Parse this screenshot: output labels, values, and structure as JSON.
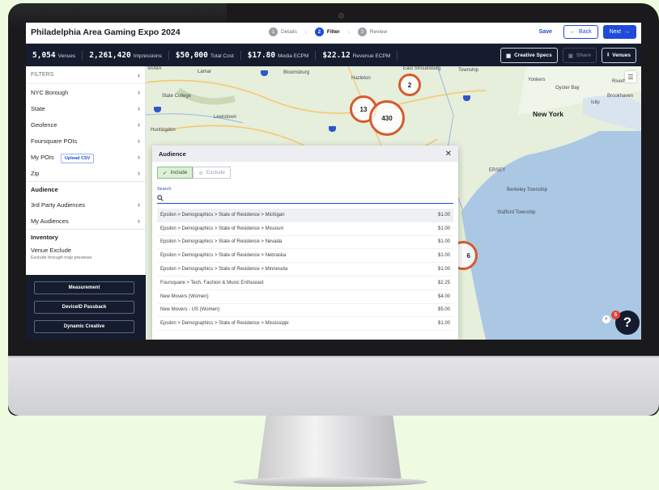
{
  "app": {
    "title": "Philadelphia Area Gaming Expo 2024"
  },
  "steps": [
    {
      "num": "1",
      "label": "Details"
    },
    {
      "num": "2",
      "label": "Filter"
    },
    {
      "num": "3",
      "label": "Review"
    }
  ],
  "actions": {
    "save": "Save",
    "back": "Back",
    "next": "Next"
  },
  "stats": [
    {
      "value": "5,054",
      "label": "Venues"
    },
    {
      "value": "2,261,420",
      "label": "Impressions"
    },
    {
      "value": "$50,000",
      "label": "Total Cost"
    },
    {
      "value": "$17.80",
      "label": "Media ECPM"
    },
    {
      "value": "$22.12",
      "label": "Revenue ECPM"
    }
  ],
  "stats_actions": {
    "creative_specs": "Creative Specs",
    "share": "Share",
    "venues": "Venues"
  },
  "sidebar": {
    "filters_label": "FILTERS",
    "filters": [
      "NYC Borough",
      "State",
      "Geofence",
      "Foursquare POIs"
    ],
    "my_pois": "My POIs",
    "upload_csv": "Upload CSV",
    "zip": "Zip",
    "audience_head": "Audience",
    "audience_items": [
      "3rd Party Audiences",
      "My Audiences"
    ],
    "inventory_head": "Inventory",
    "venue_exclude": "Venue Exclude",
    "venue_exclude_sub": "Exclude through map previews",
    "buttons": [
      "Measurement",
      "DeviceID Passback",
      "Dynamic Creative"
    ]
  },
  "map": {
    "clusters": [
      "2",
      "13",
      "430",
      "6"
    ],
    "labels": {
      "lamar": "Lamar",
      "bloomsburg": "Bloomsburg",
      "hazleton": "Hazleton",
      "east_stroudsburg": "East Stroudsburg",
      "township": "Township",
      "yonkers": "Yonkers",
      "oyster_bay": "Oyster Bay",
      "islip": "Islip",
      "brookhaven": "Brookhaven",
      "riverhead": "Riverhe",
      "new_york": "New York",
      "state_college": "State College",
      "lewistown": "Lewistown",
      "huntingdon": "Huntingdon",
      "jersey": "JERSEY",
      "berkeley": "Berkeley Township",
      "stafford": "Stafford Township",
      "vania": "VANIA",
      "ersey": "ERSEY"
    }
  },
  "modal": {
    "title": "Audience",
    "include": "Include",
    "exclude": "Exclude",
    "search_label": "Search",
    "search_placeholder": "",
    "rows": [
      {
        "name": "Epsilon > Demographics > State of Residence > Michigan",
        "price": "$1.00"
      },
      {
        "name": "Epsilon > Demographics > State of Residence > Missouri",
        "price": "$1.00"
      },
      {
        "name": "Epsilon > Demographics > State of Residence > Nevada",
        "price": "$1.00"
      },
      {
        "name": "Epsilon > Demographics > State of Residence > Nebraska",
        "price": "$1.00"
      },
      {
        "name": "Epsilon > Demographics > State of Residence > Minnesota",
        "price": "$1.00"
      },
      {
        "name": "Foursquare > Tech, Fashion & Music Enthusiast",
        "price": "$2.25"
      },
      {
        "name": "New Movers (Women)",
        "price": "$4.00"
      },
      {
        "name": "New Movers - US (Women)",
        "price": "$5.00"
      },
      {
        "name": "Epsilon > Demographics > State of Residence > Mississippi",
        "price": "$1.00"
      }
    ]
  },
  "help": {
    "badge": "5",
    "label": "?"
  }
}
